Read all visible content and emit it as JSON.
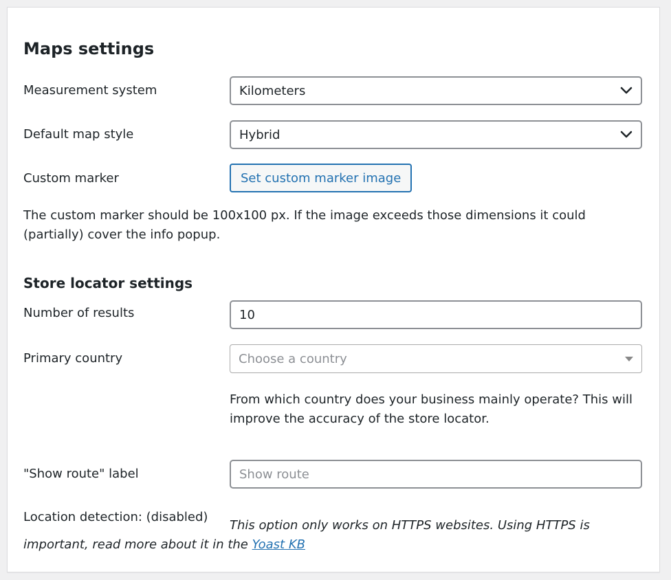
{
  "maps_settings": {
    "title": "Maps settings",
    "measurement_system": {
      "label": "Measurement system",
      "value": "Kilometers"
    },
    "default_map_style": {
      "label": "Default map style",
      "value": "Hybrid"
    },
    "custom_marker": {
      "label": "Custom marker",
      "button_label": "Set custom marker image",
      "description": "The custom marker should be 100x100 px. If the image exceeds those dimensions it could (partially) cover the info popup."
    }
  },
  "store_locator_settings": {
    "title": "Store locator settings",
    "number_of_results": {
      "label": "Number of results",
      "value": "10"
    },
    "primary_country": {
      "label": "Primary country",
      "placeholder": "Choose a country",
      "description": "From which country does your business mainly operate? This will improve the accuracy of the store locator."
    },
    "show_route_label": {
      "label": "\"Show route\" label",
      "placeholder": "Show route"
    },
    "location_detection": {
      "label": "Location detection: (disabled)",
      "note": "This option only works on HTTPS websites. Using HTTPS is important, read more about it in the ",
      "link_text": "Yoast KB"
    }
  },
  "colors": {
    "link": "#2271b1",
    "text": "#1d2327",
    "border": "#8c8f94"
  },
  "icons": {
    "select_arrow": "chevron-down-icon",
    "select2_arrow": "caret-down-icon"
  }
}
